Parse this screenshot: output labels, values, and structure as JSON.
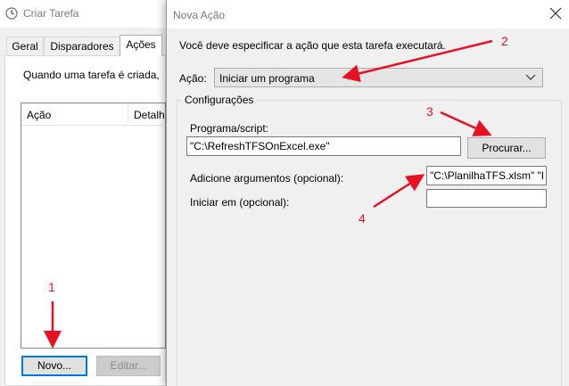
{
  "background_window": {
    "title": "Criar Tarefa",
    "tabs": [
      "Geral",
      "Disparadores",
      "Ações"
    ],
    "active_tab": "Ações",
    "description": "Quando uma tarefa é criada,",
    "list_columns": [
      "Ação",
      "Detalh"
    ],
    "buttons": {
      "new": "Novo...",
      "edit": "Editar..."
    }
  },
  "dialog": {
    "title": "Nova Ação",
    "description": "Você deve especificar a ação que esta tarefa executará.",
    "action_label": "Ação:",
    "action_value": "Iniciar um programa",
    "group_label": "Configurações",
    "program_label": "Programa/script:",
    "program_value": "\"C:\\RefreshTFSOnExcel.exe\"",
    "browse_button": "Procurar...",
    "args_label": "Adicione argumentos (opcional):",
    "args_value": "\"C:\\PlanilhaTFS.xlsm\" \"I",
    "start_label": "Iniciar em (opcional):",
    "start_value": ""
  },
  "annotations": {
    "labels": [
      "1",
      "2",
      "3",
      "4"
    ],
    "color": "#e81123"
  },
  "icons": {
    "title_icon": "task-scheduler-icon",
    "close": "close-icon",
    "dropdown": "chevron-down-icon"
  }
}
